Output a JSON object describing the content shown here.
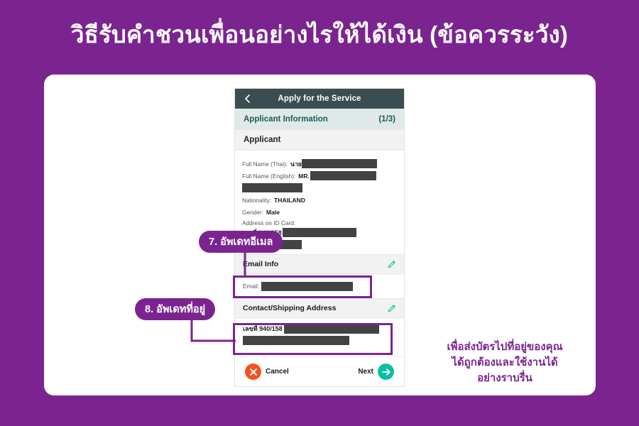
{
  "banner": {
    "title": "วิธีรับคำชวนเพื่อนอย่างไรให้ได้เงิน (ข้อควรระวัง)",
    "background_color": "#7B2490",
    "text_color": "#FFFFFF"
  },
  "phone": {
    "header": {
      "title": "Apply for the Service",
      "back_icon": "chevron-left-icon",
      "background_color": "#3A4D52"
    },
    "section_info": {
      "label": "Applicant Information",
      "count": "(1/3)",
      "background_color": "#DFE9E8",
      "text_color": "#1E5B57"
    },
    "section_applicant": {
      "label": "Applicant"
    },
    "fields": [
      {
        "label": "Full Name (Thai):",
        "value": "นาย",
        "redacted": true
      },
      {
        "label": "Full Name (English):",
        "value": "MR.",
        "redacted": true
      },
      {
        "label": "Nationality:",
        "value": "THAILAND",
        "redacted": false
      },
      {
        "label": "Gender:",
        "value": "Male",
        "redacted": false
      }
    ],
    "address_on_id": {
      "label": "Address on ID Card:",
      "value": "เลขที่ 940/158",
      "redacted": true
    },
    "email_info": {
      "label": "Email Info",
      "edit_icon": "pencil-icon",
      "field_label": "Email:",
      "field_value": "",
      "field_redacted": true
    },
    "contact_address": {
      "label": "Contact/Shipping Address",
      "edit_icon": "pencil-icon",
      "value": "เลขที่ 940/158",
      "redacted": true
    },
    "footer": {
      "cancel_label": "Cancel",
      "cancel_icon": "close-circle-icon",
      "cancel_color": "#F4511E",
      "next_label": "Next",
      "next_icon": "arrow-right-circle-icon",
      "next_color": "#0BBFA0"
    }
  },
  "callouts": [
    {
      "id": "callout-7",
      "text": "7. อัพเดทอีเมล"
    },
    {
      "id": "callout-8",
      "text": "8. อัพเดทที่อยู่"
    }
  ],
  "highlight_color": "#7B2490",
  "side_note": {
    "line1": "เพื่อส่งบัตรไปที่อยู่ของคุณ",
    "line2": "ได้ถูกต้องและใช้งานได้",
    "line3": "อย่างราบรื่น",
    "color": "#7B2490"
  }
}
